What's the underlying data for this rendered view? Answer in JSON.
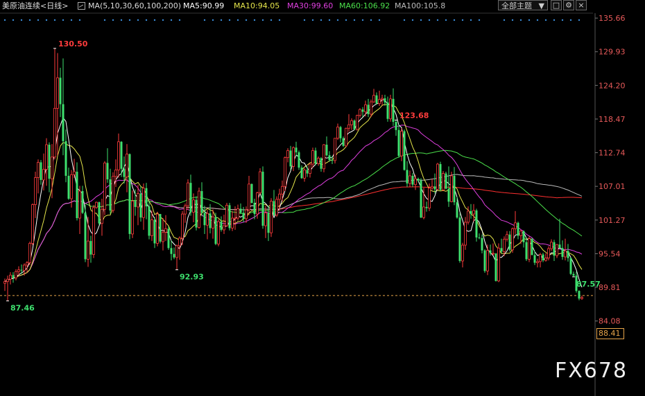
{
  "header": {
    "title": "美原油连续<日线>",
    "ma_label": "MA(5,10,30,60,100,200)",
    "ma5": "MA5:90.99",
    "ma10": "MA10:94.05",
    "ma30": "MA30:99.60",
    "ma60": "MA60:106.92",
    "ma100": "MA100:105.8",
    "theme_select": "全部主题",
    "theme_arrow": "▼",
    "btn_grid": "□",
    "btn_settings": "⚙",
    "btn_close": "×"
  },
  "colors": {
    "up": "#ff3c3c",
    "down": "#3ee06e",
    "ma5": "#ffffff",
    "ma10": "#e6e64b",
    "ma30": "#e040e0",
    "ma60": "#4be04b",
    "ma100": "#bbbbbb",
    "ma200": "#ff3030",
    "grid": "#2a2a2a",
    "last_price": "#e8a54a"
  },
  "current_price": "88.41",
  "watermark": "FX678",
  "chart_data": {
    "type": "candlestick",
    "y_ticks": [
      "135.66",
      "129.93",
      "124.20",
      "118.47",
      "112.74",
      "107.01",
      "101.27",
      "95.54",
      "89.81",
      "84.08"
    ],
    "ylim": [
      78.5,
      136.5
    ],
    "annotations": [
      {
        "label": "130.50",
        "kind": "high",
        "index": 18
      },
      {
        "label": "123.68",
        "kind": "high",
        "index": 141
      },
      {
        "label": "92.93",
        "kind": "low",
        "index": 62
      },
      {
        "label": "87.46",
        "kind": "low",
        "index": 1
      },
      {
        "label": "87.57",
        "kind": "low",
        "index": 205
      }
    ],
    "candles": [
      [
        90.5,
        91.3,
        89.2,
        90.8
      ],
      [
        90.8,
        91.8,
        87.5,
        91.2
      ],
      [
        91.2,
        92.4,
        90.3,
        91.9
      ],
      [
        91.9,
        92.4,
        90.6,
        91.4
      ],
      [
        91.4,
        92.9,
        91.0,
        92.5
      ],
      [
        92.5,
        93.4,
        91.9,
        92.8
      ],
      [
        92.8,
        93.7,
        92.1,
        92.7
      ],
      [
        92.7,
        93.9,
        91.8,
        93.6
      ],
      [
        93.6,
        94.3,
        92.3,
        94.0
      ],
      [
        94.0,
        97.6,
        93.6,
        97.3
      ],
      [
        97.3,
        104.1,
        97.0,
        103.9
      ],
      [
        103.9,
        109.5,
        101.6,
        108.5
      ],
      [
        108.5,
        111.6,
        105.8,
        111.1
      ],
      [
        111.1,
        111.5,
        107.3,
        108.1
      ],
      [
        108.1,
        112.6,
        106.3,
        109.9
      ],
      [
        109.9,
        115.2,
        107.1,
        114.1
      ],
      [
        114.1,
        114.5,
        106.0,
        108.3
      ],
      [
        108.3,
        114.2,
        105.0,
        112.0
      ],
      [
        112.0,
        130.5,
        111.6,
        120.3
      ],
      [
        120.3,
        129.7,
        112.3,
        125.5
      ],
      [
        125.5,
        127.2,
        118.8,
        121.0
      ],
      [
        121.0,
        128.8,
        112.3,
        114.7
      ],
      [
        114.7,
        116.7,
        107.7,
        108.8
      ],
      [
        108.8,
        110.2,
        104.7,
        104.9
      ],
      [
        104.9,
        109.8,
        103.4,
        109.0
      ],
      [
        109.0,
        111.7,
        108.4,
        109.5
      ],
      [
        109.5,
        111.1,
        101.2,
        101.6
      ],
      [
        101.6,
        107.1,
        98.9,
        106.2
      ],
      [
        106.2,
        107.1,
        102.3,
        102.5
      ],
      [
        102.5,
        103.9,
        94.1,
        94.6
      ],
      [
        94.6,
        101.8,
        93.3,
        97.7
      ],
      [
        97.7,
        98.6,
        94.0,
        95.4
      ],
      [
        95.4,
        103.8,
        94.8,
        103.4
      ],
      [
        103.4,
        104.4,
        103.2,
        104.3
      ],
      [
        104.3,
        104.4,
        100.4,
        100.7
      ],
      [
        100.7,
        104.9,
        98.6,
        103.1
      ],
      [
        103.1,
        111.3,
        102.1,
        111.0
      ],
      [
        111.0,
        113.5,
        107.6,
        108.2
      ],
      [
        108.2,
        110.0,
        102.3,
        102.9
      ],
      [
        102.9,
        109.4,
        102.5,
        108.7
      ],
      [
        108.7,
        111.6,
        106.9,
        109.8
      ],
      [
        109.8,
        116.0,
        108.5,
        114.6
      ],
      [
        114.6,
        114.7,
        108.6,
        110.0
      ],
      [
        110.0,
        112.1,
        107.5,
        108.6
      ],
      [
        108.6,
        114.2,
        106.0,
        112.5
      ],
      [
        112.5,
        112.6,
        98.0,
        98.9
      ],
      [
        98.9,
        106.3,
        98.2,
        104.5
      ],
      [
        104.5,
        106.5,
        102.0,
        103.5
      ],
      [
        103.5,
        107.3,
        100.4,
        105.8
      ],
      [
        105.8,
        107.0,
        101.0,
        101.7
      ],
      [
        101.7,
        107.5,
        99.6,
        106.7
      ],
      [
        106.7,
        107.6,
        101.4,
        103.6
      ],
      [
        103.6,
        104.5,
        98.0,
        98.6
      ],
      [
        98.6,
        102.9,
        97.7,
        101.3
      ],
      [
        101.3,
        101.8,
        96.5,
        97.3
      ],
      [
        97.3,
        102.7,
        96.8,
        102.3
      ],
      [
        102.3,
        102.3,
        97.3,
        97.6
      ],
      [
        97.6,
        101.6,
        96.1,
        99.2
      ],
      [
        99.2,
        102.1,
        97.7,
        99.8
      ],
      [
        99.8,
        100.2,
        96.2,
        96.5
      ],
      [
        96.5,
        97.8,
        94.4,
        95.5
      ],
      [
        95.5,
        96.6,
        94.6,
        94.9
      ],
      [
        94.9,
        97.1,
        92.8,
        96.9
      ],
      [
        96.9,
        98.5,
        94.5,
        98.2
      ],
      [
        98.2,
        102.8,
        97.0,
        102.3
      ],
      [
        102.3,
        104.1,
        100.8,
        103.7
      ],
      [
        103.7,
        108.2,
        103.0,
        107.6
      ],
      [
        107.6,
        109.0,
        102.0,
        102.6
      ],
      [
        102.6,
        105.8,
        100.9,
        104.7
      ],
      [
        104.7,
        105.3,
        99.5,
        100.0
      ],
      [
        100.0,
        106.8,
        99.8,
        106.2
      ],
      [
        106.2,
        107.7,
        101.9,
        102.5
      ],
      [
        102.5,
        103.7,
        98.9,
        100.4
      ],
      [
        100.4,
        103.0,
        98.0,
        102.4
      ],
      [
        102.4,
        104.0,
        99.0,
        99.9
      ],
      [
        99.9,
        103.1,
        98.1,
        101.8
      ],
      [
        101.8,
        102.5,
        97.0,
        97.2
      ],
      [
        97.2,
        101.4,
        96.8,
        101.0
      ],
      [
        101.0,
        101.9,
        99.3,
        99.6
      ],
      [
        99.6,
        102.2,
        98.9,
        100.3
      ],
      [
        100.3,
        104.2,
        100.1,
        103.8
      ],
      [
        103.8,
        104.2,
        99.5,
        99.9
      ],
      [
        99.9,
        102.8,
        99.4,
        101.6
      ],
      [
        101.6,
        103.6,
        99.6,
        101.6
      ],
      [
        101.6,
        103.9,
        101.2,
        103.2
      ],
      [
        103.2,
        104.1,
        102.3,
        102.5
      ],
      [
        102.5,
        103.5,
        100.9,
        101.5
      ],
      [
        101.5,
        103.6,
        100.8,
        103.0
      ],
      [
        103.0,
        108.8,
        102.1,
        107.4
      ],
      [
        107.4,
        107.5,
        104.1,
        104.2
      ],
      [
        104.2,
        104.9,
        101.4,
        102.3
      ],
      [
        102.3,
        106.1,
        101.5,
        105.9
      ],
      [
        105.9,
        110.1,
        105.6,
        109.5
      ],
      [
        109.5,
        110.4,
        99.8,
        100.3
      ],
      [
        100.3,
        103.7,
        98.2,
        102.5
      ],
      [
        102.5,
        103.7,
        97.7,
        99.1
      ],
      [
        99.1,
        105.0,
        98.4,
        104.5
      ],
      [
        104.5,
        106.4,
        102.0,
        102.1
      ],
      [
        102.1,
        105.3,
        101.8,
        104.8
      ],
      [
        104.8,
        106.6,
        102.8,
        105.7
      ],
      [
        105.7,
        108.0,
        104.4,
        107.0
      ],
      [
        107.0,
        112.1,
        106.2,
        111.9
      ],
      [
        111.9,
        113.5,
        111.1,
        113.1
      ],
      [
        113.1,
        113.9,
        109.8,
        110.4
      ],
      [
        110.4,
        113.8,
        109.6,
        113.6
      ],
      [
        113.6,
        114.6,
        112.1,
        112.8
      ],
      [
        112.8,
        113.1,
        109.8,
        110.2
      ],
      [
        110.2,
        110.6,
        108.3,
        108.4
      ],
      [
        108.4,
        110.1,
        107.8,
        109.8
      ],
      [
        109.8,
        110.4,
        108.6,
        109.2
      ],
      [
        109.2,
        110.9,
        108.5,
        110.8
      ],
      [
        110.8,
        113.6,
        110.2,
        113.1
      ],
      [
        113.1,
        113.6,
        110.6,
        110.9
      ],
      [
        110.9,
        112.1,
        110.5,
        111.8
      ],
      [
        111.8,
        112.0,
        109.5,
        110.0
      ],
      [
        110.0,
        114.2,
        109.4,
        114.1
      ],
      [
        114.1,
        115.5,
        112.1,
        112.3
      ],
      [
        112.3,
        113.0,
        111.2,
        111.5
      ],
      [
        111.5,
        112.2,
        110.8,
        111.4
      ],
      [
        111.4,
        115.2,
        110.9,
        115.2
      ],
      [
        115.2,
        117.7,
        114.9,
        117.1
      ],
      [
        117.1,
        117.3,
        114.5,
        115.2
      ],
      [
        115.2,
        115.5,
        113.7,
        113.9
      ],
      [
        113.9,
        117.0,
        113.7,
        116.9
      ],
      [
        116.9,
        119.3,
        116.3,
        117.5
      ],
      [
        117.5,
        118.6,
        116.6,
        118.2
      ],
      [
        118.2,
        118.4,
        116.6,
        116.7
      ],
      [
        116.7,
        119.2,
        116.5,
        119.1
      ],
      [
        119.1,
        120.3,
        118.7,
        120.1
      ],
      [
        120.1,
        120.5,
        118.8,
        119.7
      ],
      [
        119.7,
        121.6,
        118.9,
        120.9
      ],
      [
        120.9,
        121.9,
        118.8,
        119.3
      ],
      [
        119.3,
        121.8,
        118.8,
        121.4
      ],
      [
        121.4,
        123.6,
        121.2,
        122.5
      ],
      [
        122.5,
        123.0,
        121.0,
        121.1
      ],
      [
        121.1,
        123.3,
        120.7,
        121.8
      ],
      [
        121.8,
        122.6,
        120.8,
        122.0
      ],
      [
        122.0,
        122.6,
        120.7,
        121.3
      ],
      [
        121.3,
        122.3,
        118.0,
        118.5
      ],
      [
        118.5,
        122.6,
        118.0,
        121.9
      ],
      [
        121.9,
        123.7,
        117.3,
        118.0
      ],
      [
        118.0,
        118.3,
        115.6,
        116.6
      ],
      [
        116.6,
        117.5,
        111.9,
        112.2
      ],
      [
        112.2,
        116.9,
        111.3,
        116.4
      ],
      [
        116.4,
        116.7,
        109.7,
        109.8
      ],
      [
        109.8,
        111.3,
        106.9,
        107.5
      ],
      [
        107.5,
        109.7,
        106.9,
        108.8
      ],
      [
        108.8,
        109.3,
        106.9,
        107.3
      ],
      [
        107.3,
        109.0,
        106.4,
        108.3
      ],
      [
        108.3,
        108.5,
        107.7,
        108.0
      ],
      [
        108.0,
        108.4,
        101.6,
        101.7
      ],
      [
        101.7,
        106.8,
        101.4,
        103.5
      ],
      [
        103.5,
        104.4,
        102.7,
        103.3
      ],
      [
        103.3,
        107.5,
        102.8,
        106.7
      ],
      [
        106.7,
        108.3,
        106.4,
        107.0
      ],
      [
        107.0,
        109.2,
        105.8,
        106.5
      ],
      [
        106.5,
        111.0,
        106.4,
        110.8
      ],
      [
        110.8,
        111.2,
        106.3,
        106.4
      ],
      [
        106.4,
        109.6,
        106.2,
        109.2
      ],
      [
        109.2,
        109.5,
        106.5,
        106.6
      ],
      [
        106.6,
        110.4,
        103.5,
        104.4
      ],
      [
        104.4,
        109.5,
        104.3,
        108.8
      ],
      [
        108.8,
        110.3,
        103.8,
        104.3
      ],
      [
        104.3,
        105.2,
        101.5,
        101.7
      ],
      [
        101.7,
        102.4,
        94.0,
        94.3
      ],
      [
        94.3,
        97.4,
        93.2,
        97.0
      ],
      [
        97.0,
        101.8,
        96.2,
        100.9
      ],
      [
        100.9,
        103.6,
        100.5,
        102.8
      ],
      [
        102.8,
        104.0,
        101.5,
        102.3
      ],
      [
        102.3,
        104.0,
        101.0,
        102.9
      ],
      [
        102.9,
        103.2,
        97.6,
        98.3
      ],
      [
        98.3,
        99.0,
        98.0,
        98.2
      ],
      [
        98.2,
        98.8,
        95.6,
        96.1
      ],
      [
        96.1,
        96.3,
        92.3,
        92.6
      ],
      [
        92.6,
        97.1,
        91.9,
        96.1
      ],
      [
        96.1,
        97.1,
        95.2,
        95.6
      ],
      [
        95.6,
        97.3,
        95.3,
        95.6
      ],
      [
        95.6,
        95.6,
        90.8,
        90.9
      ],
      [
        90.9,
        97.3,
        90.7,
        96.5
      ],
      [
        96.5,
        98.1,
        95.6,
        95.9
      ],
      [
        95.9,
        98.5,
        95.1,
        98.0
      ],
      [
        98.0,
        99.4,
        97.6,
        98.8
      ],
      [
        98.8,
        99.4,
        95.9,
        96.2
      ],
      [
        96.2,
        100.0,
        95.7,
        99.8
      ],
      [
        99.8,
        102.8,
        98.9,
        100.8
      ],
      [
        100.8,
        101.0,
        98.0,
        98.6
      ],
      [
        98.6,
        99.6,
        97.2,
        99.4
      ],
      [
        99.4,
        99.5,
        96.6,
        97.5
      ],
      [
        97.5,
        98.3,
        94.3,
        94.6
      ],
      [
        94.6,
        98.5,
        94.1,
        98.1
      ],
      [
        98.1,
        98.1,
        95.3,
        95.3
      ],
      [
        95.3,
        96.0,
        93.6,
        94.0
      ],
      [
        94.0,
        94.7,
        93.2,
        94.2
      ],
      [
        94.2,
        95.7,
        93.2,
        95.4
      ],
      [
        95.4,
        95.7,
        94.1,
        94.4
      ],
      [
        94.4,
        95.6,
        94.2,
        94.8
      ],
      [
        94.8,
        96.8,
        94.4,
        96.4
      ],
      [
        96.4,
        98.0,
        96.0,
        97.5
      ],
      [
        97.5,
        97.9,
        94.3,
        95.2
      ],
      [
        95.2,
        97.2,
        94.8,
        97.1
      ],
      [
        97.1,
        101.5,
        96.4,
        96.5
      ],
      [
        96.5,
        97.8,
        94.5,
        95.0
      ],
      [
        95.0,
        98.1,
        94.4,
        96.0
      ],
      [
        96.0,
        97.2,
        94.2,
        94.8
      ],
      [
        94.8,
        94.9,
        91.9,
        92.1
      ],
      [
        92.1,
        92.5,
        91.6,
        91.8
      ],
      [
        91.8,
        92.5,
        88.9,
        89.2
      ],
      [
        89.2,
        89.3,
        87.6,
        87.9
      ],
      [
        87.9,
        88.4,
        87.7,
        88.1
      ]
    ]
  }
}
